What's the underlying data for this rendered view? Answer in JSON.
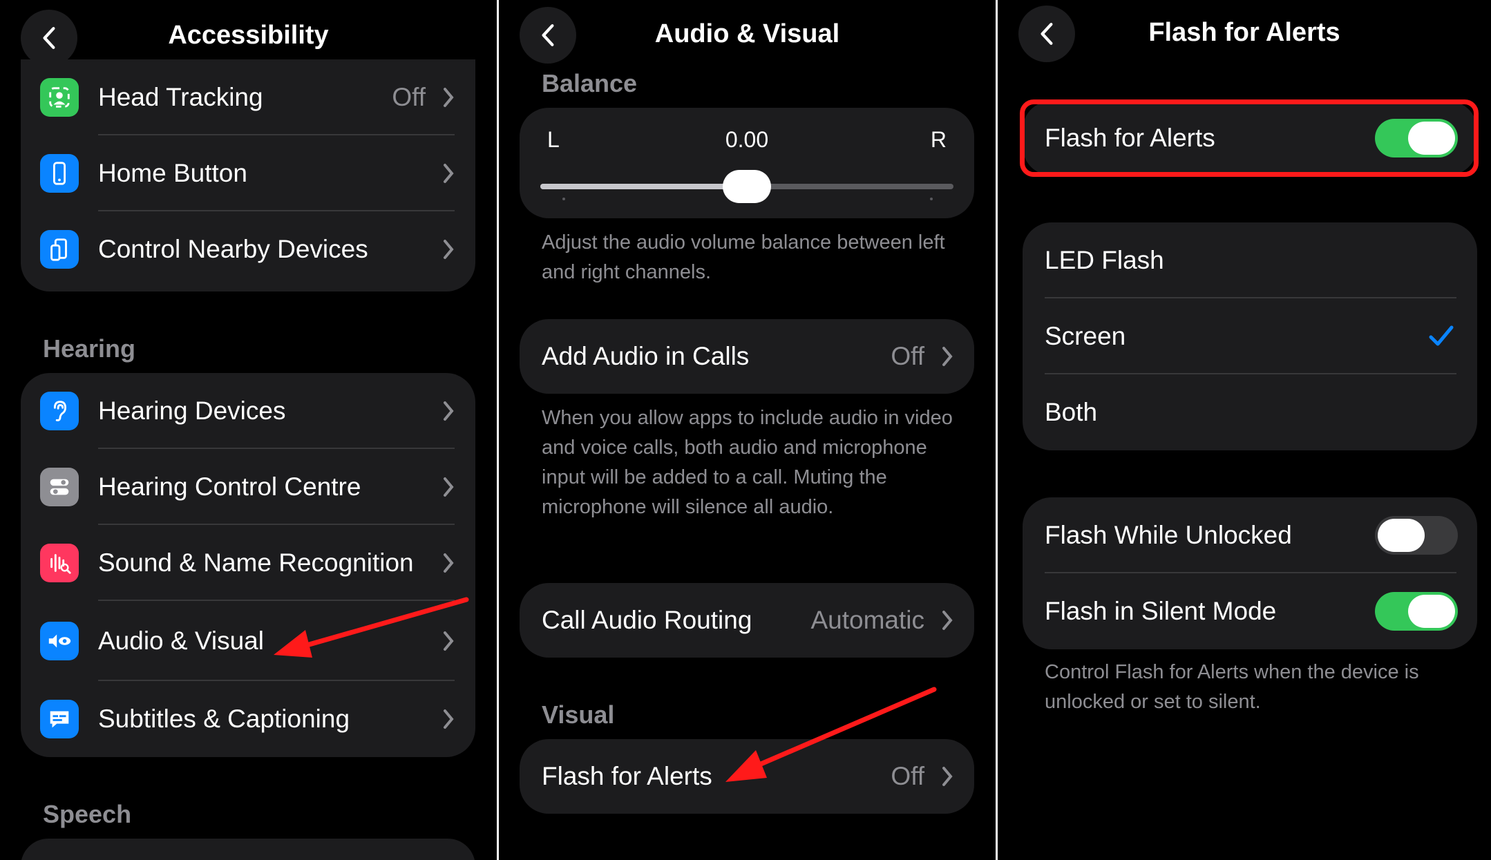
{
  "panel1": {
    "title": "Accessibility",
    "rows_top": [
      {
        "label": "Head Tracking",
        "value": "Off",
        "icon": "head-tracking-icon",
        "color": "#34c759"
      },
      {
        "label": "Home Button",
        "value": "",
        "icon": "home-button-icon",
        "color": "#0a84ff"
      },
      {
        "label": "Control Nearby Devices",
        "value": "",
        "icon": "nearby-devices-icon",
        "color": "#0a84ff"
      }
    ],
    "hearing_header": "Hearing",
    "rows_hearing": [
      {
        "label": "Hearing Devices",
        "icon": "ear-icon",
        "color": "#0a84ff"
      },
      {
        "label": "Hearing Control Centre",
        "icon": "toggles-icon",
        "color": "#8e8e93"
      },
      {
        "label": "Sound & Name Recognition",
        "icon": "waveform-icon",
        "color": "#ff375f"
      },
      {
        "label": "Audio & Visual",
        "icon": "speaker-eye-icon",
        "color": "#0a84ff"
      },
      {
        "label": "Subtitles & Captioning",
        "icon": "caption-bubble-icon",
        "color": "#0a84ff"
      }
    ],
    "speech_header": "Speech"
  },
  "panel2": {
    "title": "Audio & Visual",
    "balance_header": "Balance",
    "balance": {
      "left_label": "L",
      "right_label": "R",
      "value": "0.00",
      "position_fraction": 0.5
    },
    "balance_footnote": "Adjust the audio volume balance between left and right channels.",
    "add_audio": {
      "label": "Add Audio in Calls",
      "value": "Off"
    },
    "add_audio_footnote": "When you allow apps to include audio in video and voice calls, both audio and microphone input will be added to a call. Muting the microphone will silence all audio.",
    "call_routing": {
      "label": "Call Audio Routing",
      "value": "Automatic"
    },
    "visual_header": "Visual",
    "flash": {
      "label": "Flash for Alerts",
      "value": "Off"
    }
  },
  "panel3": {
    "title": "Flash for Alerts",
    "main_toggle": {
      "label": "Flash for Alerts",
      "on": true
    },
    "options": [
      {
        "label": "LED Flash",
        "selected": false
      },
      {
        "label": "Screen",
        "selected": true
      },
      {
        "label": "Both",
        "selected": false
      }
    ],
    "toggles": [
      {
        "label": "Flash While Unlocked",
        "on": false
      },
      {
        "label": "Flash in Silent Mode",
        "on": true
      }
    ],
    "footnote": "Control Flash for Alerts when the device is unlocked or set to silent."
  },
  "colors": {
    "accent_green": "#34c759",
    "check_blue": "#0a84ff",
    "annotation_red": "#ff1a1a"
  }
}
